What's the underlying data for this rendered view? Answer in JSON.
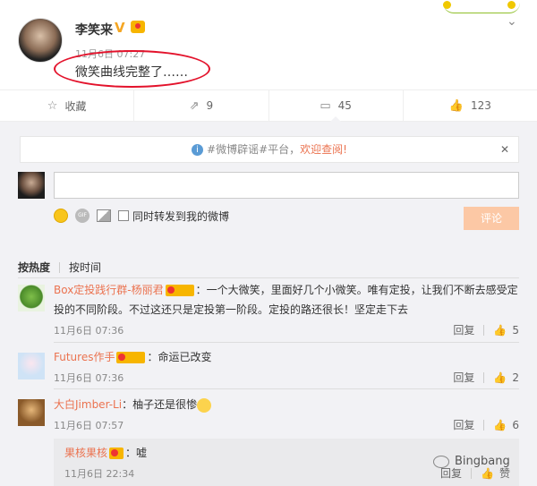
{
  "post": {
    "author": "李笑来",
    "time": "11月6日 07:27",
    "content": "微笑曲线完整了……"
  },
  "actions": [
    {
      "label": "收藏",
      "icon": "star-icon"
    },
    {
      "label": "9",
      "icon": "share-icon"
    },
    {
      "label": "45",
      "icon": "comment-icon"
    },
    {
      "label": "123",
      "icon": "like-icon"
    }
  ],
  "notice": {
    "prefix": "#微博辟谣#平台，",
    "link": "欢迎查阅!",
    "close": "✕"
  },
  "composer": {
    "repost_label": "同时转发到我的微博",
    "submit_label": "评论"
  },
  "sort": {
    "hot": "按热度",
    "time": "按时间"
  },
  "comments": [
    {
      "name": "Box定投践行群-杨丽君",
      "text": "：一个大微笑，里面好几个小微笑。唯有定投，让我们不断去感受定投的不同阶段。不过这还只是定投第一阶段。定投的路还很长！坚定走下去",
      "time": "11月6日 07:36",
      "reply": "回复",
      "likes": "5"
    },
    {
      "name": "Futures作手",
      "text": "：命运已改变",
      "time": "11月6日 07:36",
      "reply": "回复",
      "likes": "2"
    },
    {
      "name": "大白Jimber-Li",
      "text": "：柚子还是很惨",
      "time": "11月6日 07:57",
      "reply": "回复",
      "likes": "6"
    }
  ],
  "sub_reply": {
    "name": "果核果核",
    "text": "：嘘",
    "time": "11月6日 22:34",
    "reply": "回复",
    "likes": "赞"
  },
  "watermark": "Bingbang"
}
